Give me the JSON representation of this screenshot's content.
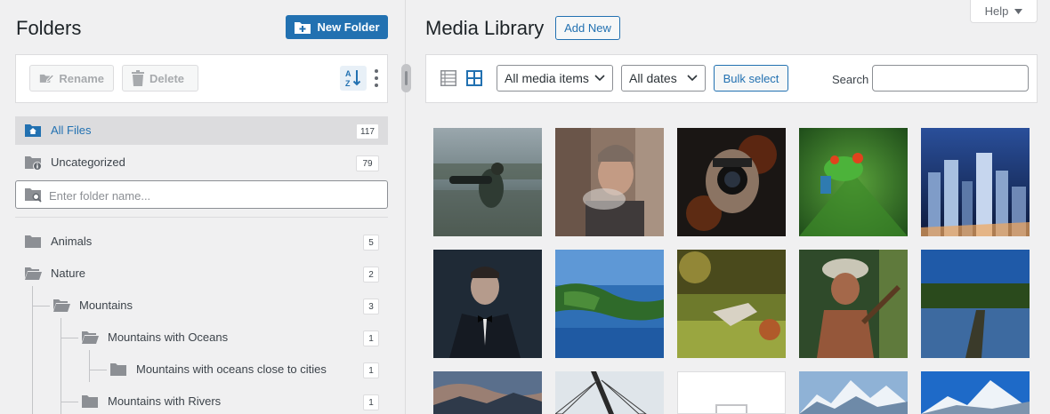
{
  "folders_panel": {
    "title": "Folders",
    "new_folder_label": "New Folder",
    "rename_label": "Rename",
    "delete_label": "Delete",
    "all_files": {
      "label": "All Files",
      "count": "117"
    },
    "uncategorized": {
      "label": "Uncategorized",
      "count": "79"
    },
    "folder_input_placeholder": "Enter folder name...",
    "tree": [
      {
        "label": "Animals",
        "count": "5"
      },
      {
        "label": "Nature",
        "count": "2"
      },
      {
        "label": "Mountains",
        "count": "3"
      },
      {
        "label": "Mountains with Oceans",
        "count": "1"
      },
      {
        "label": "Mountains with oceans close to cities",
        "count": "1"
      },
      {
        "label": "Mountains with Rivers",
        "count": "1"
      }
    ]
  },
  "help_label": "Help",
  "media": {
    "title": "Media Library",
    "add_new_label": "Add New",
    "type_filter": "All media items",
    "date_filter": "All dates",
    "bulk_select_label": "Bulk select",
    "search_label": "Search"
  },
  "colors": {
    "accent": "#2271b1",
    "panel_bg": "#f0f0f1",
    "border": "#dcdcde"
  }
}
